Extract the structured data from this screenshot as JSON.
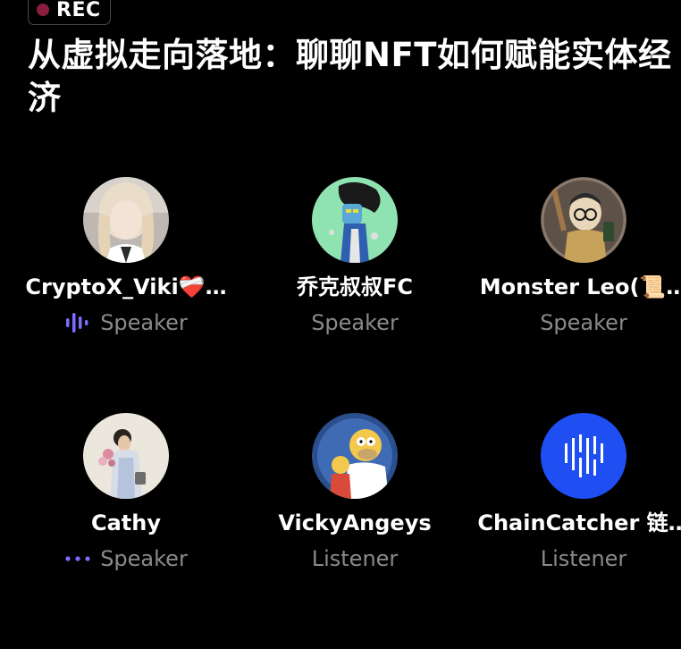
{
  "recording": {
    "label": "REC",
    "dot_color": "#8b1e3f"
  },
  "space": {
    "title": "从虚拟走向落地：聊聊NFT如何赋能实体经济"
  },
  "participants": [
    {
      "name": "CryptoX_Viki❤️‍🩹…",
      "role": "Speaker",
      "indicator": "speaking-bars-icon",
      "avatar": "woman-blonde-photo"
    },
    {
      "name": "乔克叔叔FC",
      "role": "Speaker",
      "indicator": "",
      "avatar": "green-nft-art"
    },
    {
      "name": "Monster Leo(📜…",
      "role": "Speaker",
      "indicator": "",
      "avatar": "cartoon-glasses-boy"
    },
    {
      "name": "Cathy",
      "role": "Speaker",
      "indicator": "typing-dots-icon",
      "avatar": "woman-flowers-photo"
    },
    {
      "name": "VickyAngeys",
      "role": "Listener",
      "indicator": "",
      "avatar": "homer-simpson"
    },
    {
      "name": "ChainCatcher 链…",
      "role": "Listener",
      "indicator": "",
      "avatar": "chaincatcher-logo"
    }
  ],
  "colors": {
    "accent": "#7c6cff",
    "muted": "#8a8a8a",
    "chaincatcher_blue": "#1f4ff2"
  }
}
